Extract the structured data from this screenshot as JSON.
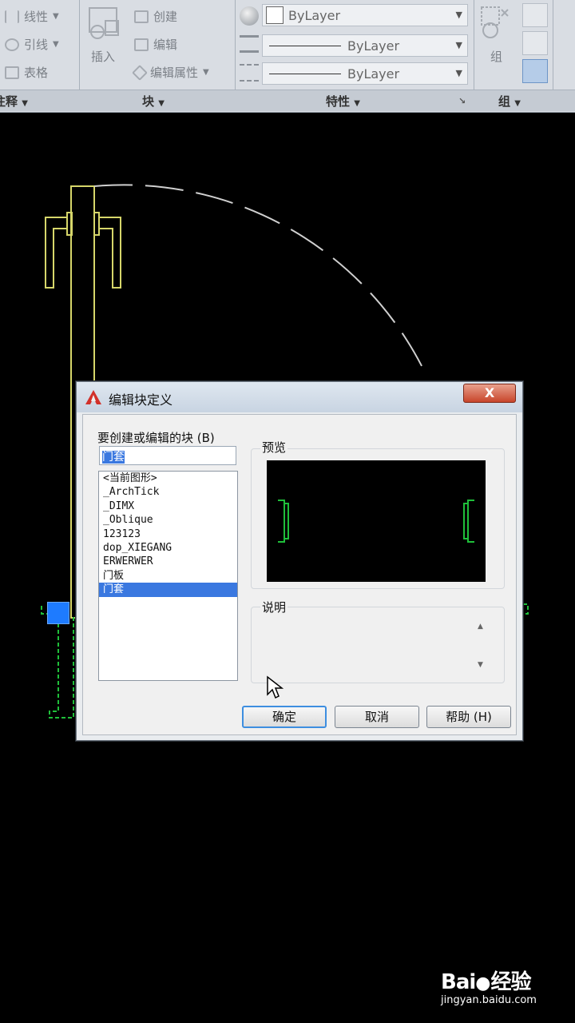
{
  "ribbon": {
    "annotation_panel": {
      "items": [
        "线性",
        "引线",
        "表格"
      ],
      "title": "注释"
    },
    "block_panel": {
      "insert_label": "插入",
      "items": [
        "创建",
        "编辑",
        "编辑属性"
      ],
      "title": "块"
    },
    "properties_panel": {
      "color": "ByLayer",
      "linetype": "ByLayer",
      "lineweight": "ByLayer",
      "title": "特性"
    },
    "group_panel": {
      "group_label": "组",
      "title": "组"
    }
  },
  "dialog": {
    "title": "编辑块定义",
    "close_label": "X",
    "name_label": "要创建或编辑的块 (B)",
    "name_value": "门套",
    "blocks": [
      "<当前图形>",
      "_ArchTick",
      "_DIMX",
      "_Oblique",
      "123123",
      "dop_XIEGANG",
      "ERWERWER",
      "门板",
      "门套"
    ],
    "selected_block": "门套",
    "preview_label": "预览",
    "description_label": "说明",
    "description_value": "",
    "buttons": {
      "ok": "确定",
      "cancel": "取消",
      "help": "帮助 (H)"
    }
  },
  "watermark": {
    "brand": "Bai",
    "brand_tail": "经验",
    "url": "jingyan.baidu.com"
  },
  "colors": {
    "drawing_yellow": "#d6d66a",
    "drawing_green": "#1fbf3a",
    "selection_blue": "#3a78e0",
    "grip_blue": "#1e7bff"
  }
}
